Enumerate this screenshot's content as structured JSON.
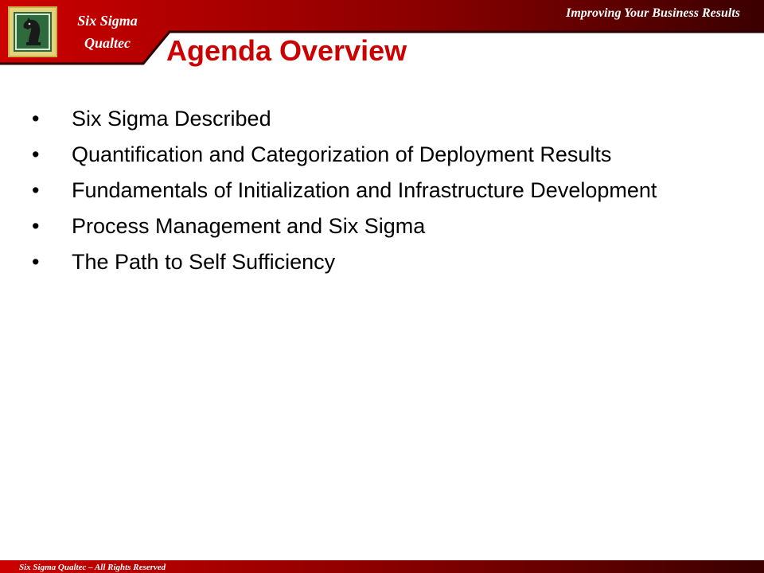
{
  "header": {
    "brand_name_line1": "Six Sigma",
    "brand_name_line2": "Qualtec",
    "tagline": "Improving Your Business Results",
    "logo_icon": "chess-knight-icon"
  },
  "main": {
    "title": "Agenda Overview",
    "bullet_glyph": "•",
    "items": [
      {
        "text": "Six Sigma Described"
      },
      {
        "text": "Quantification and Categorization of Deployment Results"
      },
      {
        "text": "Fundamentals of Initialization and Infrastructure Development"
      },
      {
        "text": "Process Management and Six Sigma"
      },
      {
        "text": "The Path to Self Sufficiency"
      }
    ]
  },
  "footer": {
    "text": "Six Sigma Qualtec – All Rights Reserved"
  },
  "colors": {
    "title": "#cc0000",
    "header_red": "#cc0000",
    "header_dark": "#3a0000",
    "logo_gold": "#e6d27a",
    "logo_green": "#2e6b3c"
  }
}
